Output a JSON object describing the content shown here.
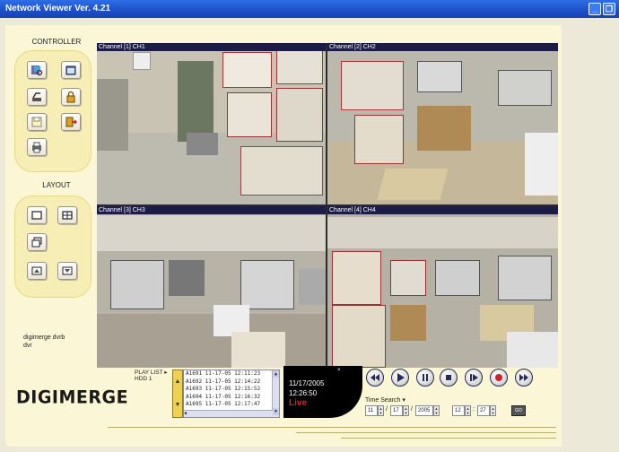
{
  "window": {
    "title": "Network Viewer Ver. 4.21"
  },
  "controller": {
    "title": "CONTROLLER"
  },
  "layout": {
    "title": "LAYOUT"
  },
  "channels": [
    {
      "label": "Channel [1]  CH1"
    },
    {
      "label": "Channel [2]  CH2"
    },
    {
      "label": "Channel [3]  CH3"
    },
    {
      "label": "Channel [4]  CH4"
    }
  ],
  "site": {
    "line1": "digimerge dvrb",
    "line2": "dvr"
  },
  "logo": "DIGIMERGE",
  "playlist": {
    "label": "PLAY LIST ▸",
    "drive": "HDD 1",
    "items": [
      "A1691 11-17-05 12:11:23",
      "A1692 11-17-05 12:14:22",
      "A1693 11-17-05 12:15:52",
      "A1694 11-17-05 12:16:32",
      "A1695 11-17-05 12:17:47"
    ]
  },
  "status": {
    "date": "11/17/2005",
    "time": "12:26:50",
    "mode": "Live"
  },
  "time_search": {
    "label": "Time Search ▾",
    "month": "11",
    "day": "17",
    "year": "2005",
    "hour": "12",
    "minute": "27",
    "go_label": "GO"
  },
  "colors": {
    "titlebar": "#1c4fc7",
    "panel": "#f7eeb6",
    "live": "#e02020",
    "record": "#d0202a"
  }
}
